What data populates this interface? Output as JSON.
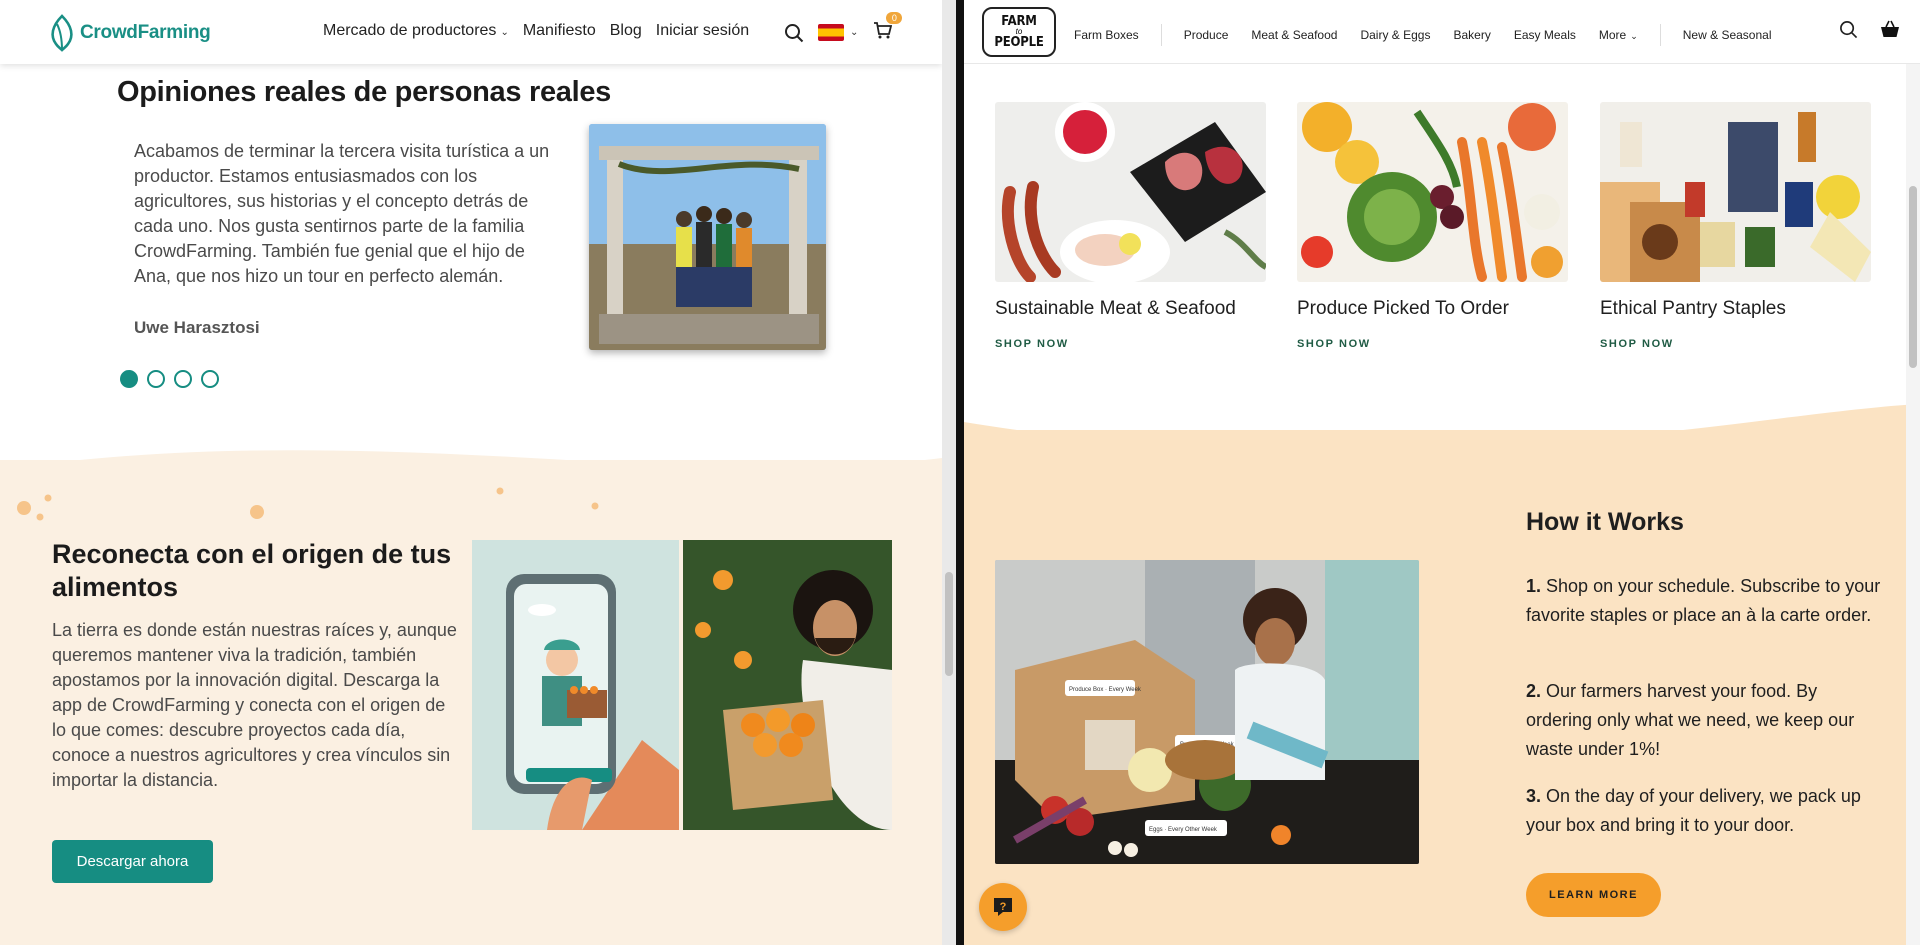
{
  "left": {
    "brand": "CrowdFarming",
    "nav": {
      "market": "Mercado de productores",
      "manifesto": "Manifiesto",
      "blog": "Blog",
      "login": "Iniciar sesión"
    },
    "cart_count": "0",
    "reviews": {
      "title": "Opiniones reales de personas reales",
      "quote": "Acabamos de terminar la tercera visita turística a un productor. Estamos entusiasmados con los agricultores, sus historias y el concepto detrás de cada uno. Nos gusta sentirnos parte de la familia CrowdFarming. También fue genial que el hijo de Ana, que nos hizo un tour en perfecto alemán.",
      "author": "Uwe Harasztosi",
      "slide_count": 4,
      "active_slide": 1
    },
    "reconnect": {
      "title": "Reconecta con el origen de tus alimentos",
      "body": "La tierra es donde están nuestras raíces y, aunque queremos mantener viva la tradición, también apostamos por la innovación digital. Descarga la app de CrowdFarming y conecta con el origen de lo que comes: descubre proyectos cada día, conoce a nuestros agricultores y crea vínculos sin importar la distancia.",
      "button": "Descargar ahora"
    },
    "colors": {
      "accent": "#168d82",
      "cream": "#fbf0e2",
      "badge": "#f0a63a"
    }
  },
  "right": {
    "logo_line1": "FARM",
    "logo_to": "to",
    "logo_line2": "PEOPLE",
    "nav": {
      "farm_boxes": "Farm Boxes",
      "produce": "Produce",
      "meat": "Meat & Seafood",
      "dairy": "Dairy & Eggs",
      "bakery": "Bakery",
      "easy_meals": "Easy Meals",
      "more": "More",
      "new_seasonal": "New & Seasonal"
    },
    "cards": [
      {
        "title": "Sustainable Meat & Seafood",
        "cta": "SHOP NOW"
      },
      {
        "title": "Produce Picked To Order",
        "cta": "SHOP NOW"
      },
      {
        "title": "Ethical Pantry Staples",
        "cta": "SHOP NOW"
      }
    ],
    "how": {
      "title": "How it Works",
      "steps": [
        {
          "num": "1.",
          "text": "Shop on your schedule. Subscribe to your favorite staples or place an à la carte order."
        },
        {
          "num": "2.",
          "text": "Our farmers harvest your food. By ordering only what we need, we keep our waste under 1%!"
        },
        {
          "num": "3.",
          "text": "On the day of your delivery, we pack up your box and bring it to your door."
        }
      ],
      "button": "LEARN MORE"
    },
    "photo_labels": {
      "box": "Produce Box · Every Week",
      "bread": "Bread · Every Week",
      "eggs": "Eggs · Every Other Week"
    },
    "colors": {
      "accent": "#f59e2b",
      "peach": "#fbe3c3",
      "shop": "#1f5b44"
    }
  }
}
